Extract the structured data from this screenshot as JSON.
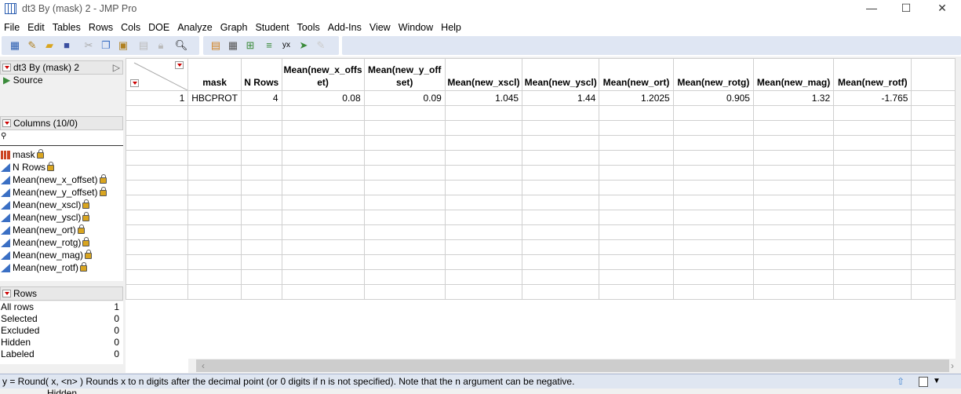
{
  "window": {
    "title": "dt3 By (mask) 2 - JMP Pro",
    "minimize": "—",
    "maximize": "☐",
    "close": "✕"
  },
  "menu": [
    "File",
    "Edit",
    "Tables",
    "Rows",
    "Cols",
    "DOE",
    "Analyze",
    "Graph",
    "Student",
    "Tools",
    "Add-Ins",
    "View",
    "Window",
    "Help"
  ],
  "table_panel": {
    "title": "dt3 By (mask) 2",
    "source": "Source"
  },
  "columns_panel": {
    "title": "Columns (10/0)",
    "items": [
      "mask",
      "N Rows",
      "Mean(new_x_offset)",
      "Mean(new_y_offset)",
      "Mean(new_xscl)",
      "Mean(new_yscl)",
      "Mean(new_ort)",
      "Mean(new_rotg)",
      "Mean(new_mag)",
      "Mean(new_rotf)"
    ]
  },
  "rows_panel": {
    "title": "Rows",
    "items": [
      {
        "label": "All rows",
        "value": "1"
      },
      {
        "label": "Selected",
        "value": "0"
      },
      {
        "label": "Excluded",
        "value": "0"
      },
      {
        "label": "Hidden",
        "value": "0"
      },
      {
        "label": "Labeled",
        "value": "0"
      }
    ]
  },
  "grid": {
    "headers": [
      "mask",
      "N Rows",
      "Mean(new_x_offset)",
      "Mean(new_y_offset)",
      "Mean(new_xscl)",
      "Mean(new_yscl)",
      "Mean(new_ort)",
      "Mean(new_rotg)",
      "Mean(new_mag)",
      "Mean(new_rotf)"
    ],
    "rows": [
      {
        "n": "1",
        "cells": [
          "HBCPROT",
          "4",
          "0.08",
          "0.09",
          "1.045",
          "1.44",
          "1.2025",
          "0.905",
          "1.32",
          "-1.765"
        ]
      }
    ]
  },
  "status": {
    "text": "y = Round( x, <n> )  Rounds x to n digits after the decimal point (or 0 digits if n is not specified). Note that the n argument can be negative."
  },
  "below_text": "Hidden"
}
